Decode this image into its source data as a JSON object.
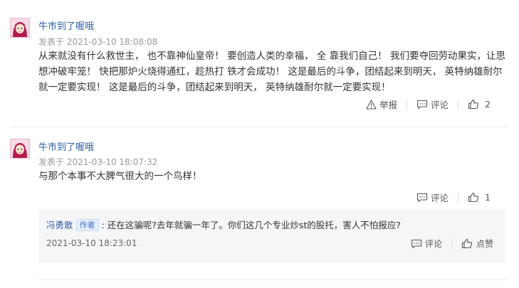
{
  "comments": [
    {
      "username": "牛市到了喔哦",
      "posted_prefix": "发表于",
      "timestamp": "2021-03-10 18:08:08",
      "text": "从来就没有什么救世主， 也不靠神仙皇帝！ 要创造人类的幸福， 全 靠我们自己！ 我们要夺回劳动果实，让思想冲破牢笼！ 快把那炉火烧得通红，趁热打 铁才会成功！ 这是最后的斗争，团结起来到明天， 英特纳雄耐尔就一定要实现！ 这是最后的斗争，团结起来到明天， 英特纳雄耐尔就一定要实现！",
      "report_label": "举报",
      "comment_label": "评论",
      "like_count": "2"
    },
    {
      "username": "牛市到了喔哦",
      "posted_prefix": "发表于",
      "timestamp": "2021-03-10 18:07:32",
      "text": "与那个本事不大脾气很大的一个鸟样！",
      "comment_label": "评论",
      "like_count": "1",
      "reply": {
        "username": "冯勇敢",
        "badge": "作者",
        "text": ": 还在这骗呢?去年就骗一年了。你们这几个专业炒st的股托，害人不怕报应?",
        "timestamp": "2021-03-10 18:23:01",
        "comment_label": "评论",
        "like_label": "点赞"
      }
    }
  ],
  "icons": {
    "report": "warning-triangle-icon",
    "comment": "comment-bubble-icon",
    "like": "thumbs-up-icon",
    "avatar": "anime-girl-avatar"
  },
  "colors": {
    "username": "#2f5fa4",
    "badge_bg": "#e6eef9",
    "reply_bg": "#f5f6f8"
  }
}
